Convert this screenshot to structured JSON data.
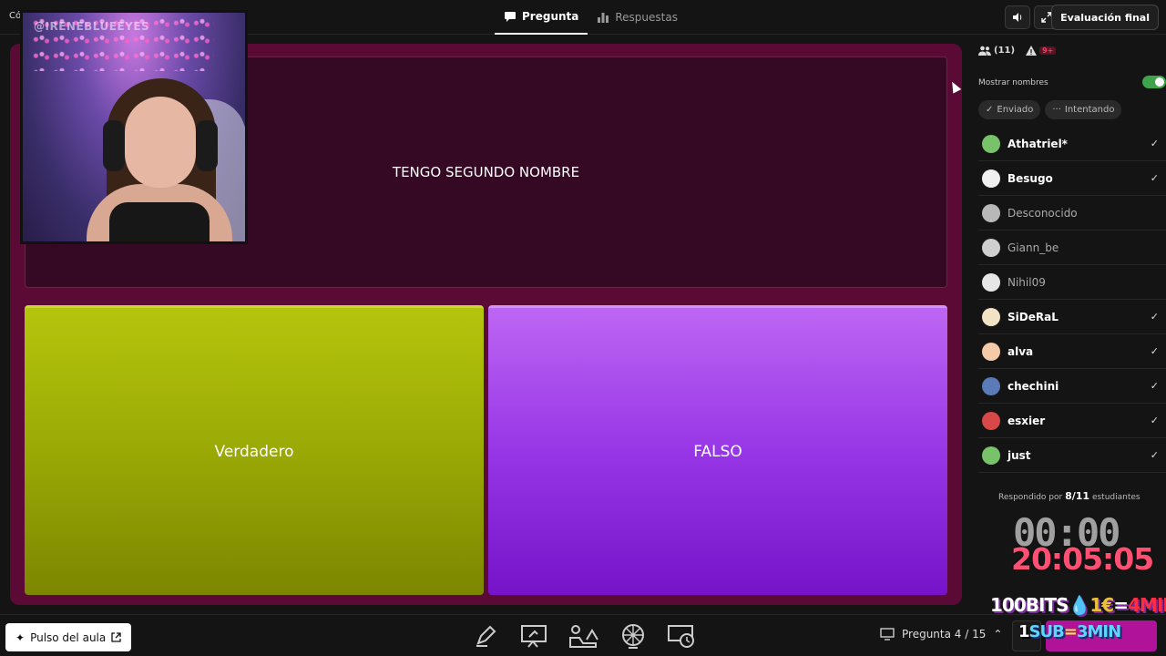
{
  "top": {
    "code_label": "Có",
    "tabs": [
      {
        "label": "Pregunta",
        "icon": "chat-bubble-icon",
        "active": true
      },
      {
        "label": "Respuestas",
        "icon": "bar-chart-icon",
        "active": false
      }
    ],
    "sound_icon": "volume-icon",
    "fullscreen_icon": "expand-icon",
    "eval_label": "Evaluación final"
  },
  "webcam": {
    "overlay_text": "@IRENEBLUEEYES"
  },
  "question": {
    "text": "TENGO SEGUNDO NOMBRE"
  },
  "answers": [
    {
      "label": "Verdadero",
      "color": "#9aa905"
    },
    {
      "label": "FALSO",
      "color": "#9736e6"
    }
  ],
  "panel": {
    "participants": "(11)",
    "alerts": "9+",
    "show_names_label": "Mostrar nombres",
    "show_names_on": true,
    "filters": [
      {
        "label": "Enviado",
        "icon": "check-icon"
      },
      {
        "label": "Intentando",
        "icon": "dots-icon"
      }
    ],
    "students": [
      {
        "name": "Athatriel*",
        "submitted": true,
        "avatar_color": "#78c26a"
      },
      {
        "name": "Besugo",
        "submitted": true,
        "avatar_color": "#f0f0f0"
      },
      {
        "name": "Desconocido",
        "submitted": false,
        "avatar_color": "#b8b8b8"
      },
      {
        "name": "Giann_be",
        "submitted": false,
        "avatar_color": "#cfcfcf"
      },
      {
        "name": "Nihil09",
        "submitted": false,
        "avatar_color": "#e6e6e6"
      },
      {
        "name": "SiDeRaL",
        "submitted": true,
        "avatar_color": "#f2e3c4"
      },
      {
        "name": "alva",
        "submitted": true,
        "avatar_color": "#f4caa8"
      },
      {
        "name": "chechini",
        "submitted": true,
        "avatar_color": "#5a7ab8"
      },
      {
        "name": "esxier",
        "submitted": true,
        "avatar_color": "#d84848"
      },
      {
        "name": "just",
        "submitted": true,
        "avatar_color": "#78c26a"
      }
    ],
    "answered_prefix": "Respondido por",
    "answered_count": "8/11",
    "answered_suffix": "estudiantes",
    "timer": "00:00",
    "clock": "20:05:05"
  },
  "promo_top": {
    "a": "100",
    "b": "BITS",
    "c": "💧",
    "d": "1€",
    "e": "=",
    "f": "4",
    "g": "MIN"
  },
  "promo_bottom": {
    "a": "1",
    "b": "SUB",
    "c": "=",
    "d": "3MIN"
  },
  "bottom": {
    "pulse_label": "Pulso del aula",
    "tools": [
      "pen-icon",
      "presentation-edit-icon",
      "shapes-icon",
      "wheel-icon",
      "timer-icon"
    ],
    "question_nav": "Pregunta 4 / 15"
  },
  "colors": {
    "frame": "#5a0a34",
    "question_bg": "#350823",
    "accent_toggle": "#3fa34d",
    "clock": "#ff4f73"
  }
}
